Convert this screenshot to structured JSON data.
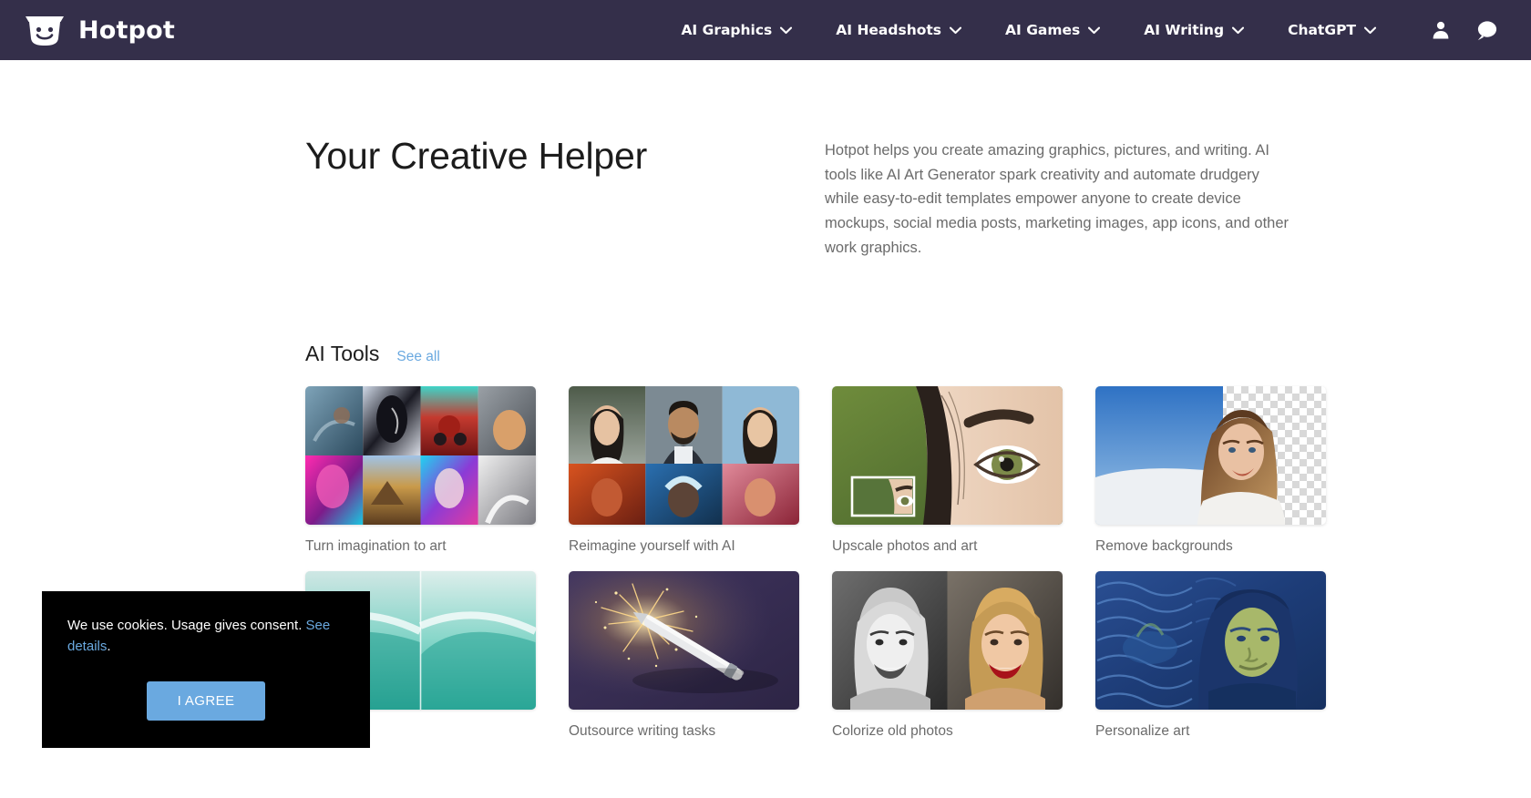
{
  "header": {
    "brand": {
      "name": "Hotpot",
      "logo_icon": "hotpot-smiley-logo"
    },
    "nav_items": [
      {
        "label": "AI Graphics",
        "icon": "chevron-down-icon"
      },
      {
        "label": "AI Headshots",
        "icon": "chevron-down-icon"
      },
      {
        "label": "AI Games",
        "icon": "chevron-down-icon"
      },
      {
        "label": "AI Writing",
        "icon": "chevron-down-icon"
      },
      {
        "label": "ChatGPT",
        "icon": "chevron-down-icon"
      }
    ],
    "icons": [
      {
        "name": "account-person-icon"
      },
      {
        "name": "chat-bubble-icon"
      }
    ],
    "background_color": "#342f4a"
  },
  "hero": {
    "title": "Your Creative Helper",
    "paragraph": "Hotpot helps you create amazing graphics, pictures, and writing. AI tools like AI Art Generator spark creativity and automate drudgery while easy-to-edit templates empower anyone to create device mockups, social media posts, marketing images, app icons, and other work graphics."
  },
  "tools_section": {
    "title": "AI Tools",
    "see_all_label": "See all",
    "link_color": "#6aa9e0",
    "tools": [
      {
        "caption": "Turn imagination to art",
        "thumb": "ai-art-grid"
      },
      {
        "caption": "Reimagine yourself with AI",
        "thumb": "headshots-grid"
      },
      {
        "caption": "Upscale photos and art",
        "thumb": "upscale-eye-closeup"
      },
      {
        "caption": "Remove backgrounds",
        "thumb": "background-remove-checker"
      },
      {
        "caption": "",
        "thumb": "object-remove-wave"
      },
      {
        "caption": "Outsource writing tasks",
        "thumb": "writing-sparkler-pen"
      },
      {
        "caption": "Colorize old photos",
        "thumb": "colorize-portrait"
      },
      {
        "caption": "Personalize art",
        "thumb": "style-transfer-mona-lisa"
      }
    ]
  },
  "cookie_banner": {
    "text_before_link": "We use cookies. Usage gives consent. ",
    "link_label": "See details",
    "text_after_link": ".",
    "agree_button": "I AGREE",
    "background_color": "#000000",
    "button_color": "#6aa9e0"
  }
}
